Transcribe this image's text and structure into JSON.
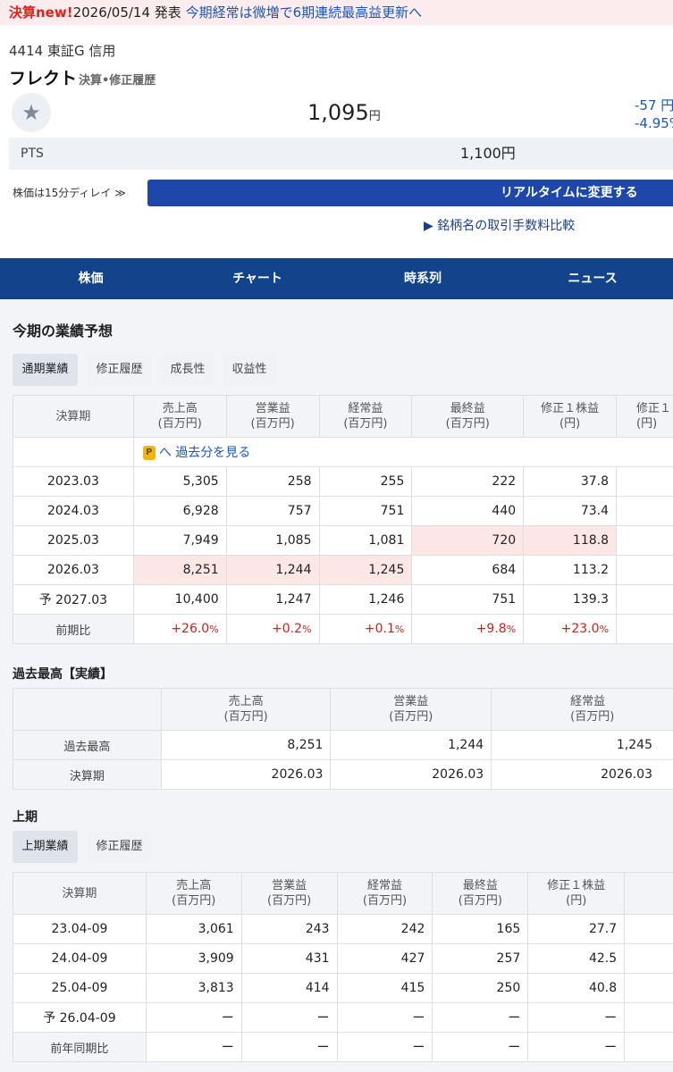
{
  "banner": {
    "tag": "決算new!",
    "date": "2026/05/14 発表",
    "headline": "今期経常は微増で6期連続最高益更新へ"
  },
  "stock": {
    "code_line": "4414 東証G 信用",
    "name": "フレクト",
    "history_link": "決算•修正履歴",
    "price": "1,095",
    "unit": "円",
    "change": "-57 円",
    "change_pct": "-4.95%"
  },
  "pts": {
    "label": "PTS",
    "value": "1,100円"
  },
  "delay": {
    "text": "株価は15分ディレイ ≫",
    "button": "リアルタイムに変更する"
  },
  "fee_link": "▶ 銘柄名の取引手数料比較",
  "nav": [
    "株価",
    "チャート",
    "時系列",
    "ニュース"
  ],
  "forecast": {
    "title": "今期の業績予想",
    "tabs": [
      "通期業績",
      "修正履歴",
      "成長性",
      "収益性"
    ],
    "headers": [
      [
        "決算期",
        ""
      ],
      [
        "売上高",
        "(百万円)"
      ],
      [
        "営業益",
        "(百万円)"
      ],
      [
        "経常益",
        "(百万円)"
      ],
      [
        "最終益",
        "(百万円)"
      ],
      [
        "修正１株益",
        "(円)"
      ],
      [
        "修正１",
        "(円)"
      ]
    ],
    "past_link": "へ 過去分を見る",
    "rows": [
      [
        "2023.03",
        "5,305",
        "258",
        "255",
        "222",
        "37.8"
      ],
      [
        "2024.03",
        "6,928",
        "757",
        "751",
        "440",
        "73.4"
      ],
      [
        "2025.03",
        "7,949",
        "1,085",
        "1,081",
        "720",
        "118.8"
      ],
      [
        "2026.03",
        "8,251",
        "1,244",
        "1,245",
        "684",
        "113.2"
      ],
      [
        "予 2027.03",
        "10,400",
        "1,247",
        "1,246",
        "751",
        "139.3"
      ]
    ],
    "ratio_label": "前期比",
    "ratio": [
      [
        "+26.0",
        "%"
      ],
      [
        "+0.2",
        "%"
      ],
      [
        "+0.1",
        "%"
      ],
      [
        "+9.8",
        "%"
      ],
      [
        "+23.0",
        "%"
      ]
    ]
  },
  "record": {
    "title": "過去最高【実績】",
    "headers": [
      [
        "売上高",
        "(百万円)"
      ],
      [
        "営業益",
        "(百万円)"
      ],
      [
        "経常益",
        "(百万円)"
      ]
    ],
    "rows": [
      [
        "過去最高",
        "8,251",
        "1,244",
        "1,245"
      ],
      [
        "決算期",
        "2026.03",
        "2026.03",
        "2026.03"
      ]
    ]
  },
  "half": {
    "title": "上期",
    "tabs": [
      "上期業績",
      "修正履歴"
    ],
    "headers": [
      [
        "決算期",
        ""
      ],
      [
        "売上高",
        "(百万円)"
      ],
      [
        "営業益",
        "(百万円)"
      ],
      [
        "経常益",
        "(百万円)"
      ],
      [
        "最終益",
        "(百万円)"
      ],
      [
        "修正１株益",
        "(円)"
      ]
    ],
    "rows": [
      [
        "23.04-09",
        "3,061",
        "243",
        "242",
        "165",
        "27.7"
      ],
      [
        "24.04-09",
        "3,909",
        "431",
        "427",
        "257",
        "42.5"
      ],
      [
        "25.04-09",
        "3,813",
        "414",
        "415",
        "250",
        "40.8"
      ],
      [
        "予 26.04-09",
        "ー",
        "ー",
        "ー",
        "ー",
        "ー"
      ]
    ],
    "ratio_label": "前年同期比",
    "ratio": [
      "ー",
      "ー",
      "ー",
      "ー",
      "ー"
    ]
  }
}
